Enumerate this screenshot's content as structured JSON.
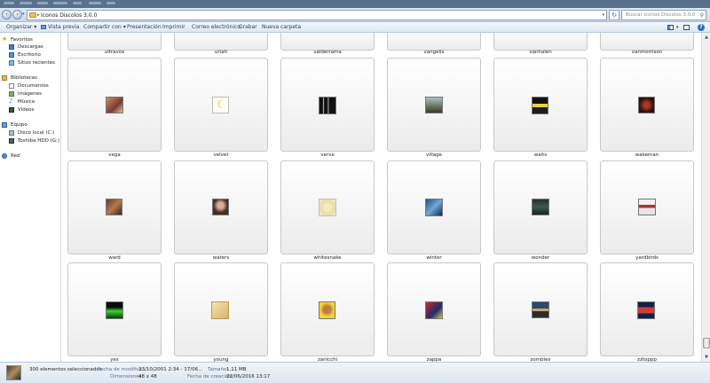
{
  "window": {
    "title": "Iconos Discolos 3.0.0"
  },
  "address": {
    "path": "Iconos Discolos 3.0.0",
    "search_placeholder": "Buscar Iconos Discolos 3.0.0"
  },
  "toolbar": {
    "organize": "Organizar",
    "preview": "Vista previa",
    "share": "Compartir con",
    "slideshow": "Presentación",
    "print": "Imprimir",
    "email": "Correo electrónico",
    "burn": "Grabar",
    "new_folder": "Nueva carpeta",
    "help": "?"
  },
  "nav": {
    "favorites": "Favoritos",
    "downloads": "Descargas",
    "desktop": "Escritorio",
    "recent": "Sitios recientes",
    "libraries": "Bibliotecas",
    "documents": "Documentos",
    "images": "Imágenes",
    "music": "Música",
    "videos": "Vídeos",
    "computer": "Equipo",
    "local_disk": "Disco local (C:)",
    "hdd": "Toshiba HDD (G:)",
    "network": "Red"
  },
  "grid": {
    "row0": [
      "ultravox",
      "uriah",
      "valderrama",
      "vangelis",
      "vanhalen",
      "vanmorrison"
    ],
    "row1": [
      "vega",
      "velvet",
      "verve",
      "village",
      "waits",
      "wakeman"
    ],
    "row2": [
      "ward",
      "waters",
      "whitesnake",
      "winter",
      "wonder",
      "yardbirds"
    ],
    "row3": [
      "yes",
      "young",
      "zanicchi",
      "zappa",
      "zombies",
      "zztoppp"
    ]
  },
  "details": {
    "selected": "300 elementos seleccionados",
    "modified_label": "Fecha de modifica...",
    "modified_value": "23/10/2001 2:34 - 17/06...",
    "size_label": "Tamaño:",
    "size_value": "1,11 MB",
    "dimensions_label": "Dimensiones:",
    "dimensions_value": "48 x 48",
    "created_label": "Fecha de creación:",
    "created_value": "22/06/2016 13:17"
  }
}
